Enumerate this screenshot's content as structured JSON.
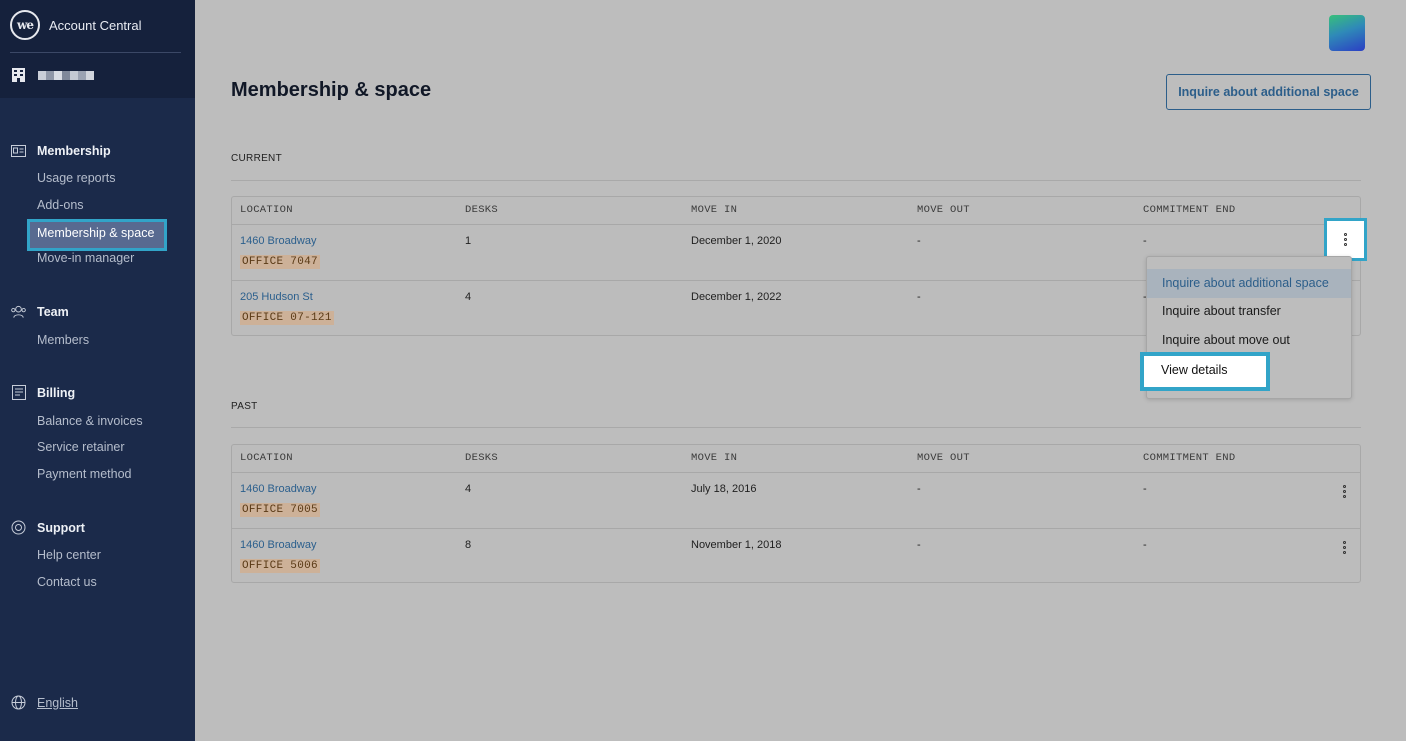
{
  "app": {
    "name": "Account Central",
    "logo_text": "we"
  },
  "sidebar": {
    "sections": [
      {
        "label": "Membership",
        "icon": "id-card-icon",
        "items": [
          "Usage reports",
          "Add-ons",
          "Membership & space",
          "Move-in manager"
        ],
        "active": "Membership & space"
      },
      {
        "label": "Team",
        "icon": "team-icon",
        "items": [
          "Members"
        ]
      },
      {
        "label": "Billing",
        "icon": "receipt-icon",
        "items": [
          "Balance & invoices",
          "Service retainer",
          "Payment method"
        ]
      },
      {
        "label": "Support",
        "icon": "lifebuoy-icon",
        "items": [
          "Help center",
          "Contact us"
        ]
      }
    ],
    "language": "English"
  },
  "header": {
    "title": "Membership & space",
    "inquire_button": "Inquire about additional space"
  },
  "columns": [
    "LOCATION",
    "DESKS",
    "MOVE IN",
    "MOVE OUT",
    "COMMITMENT END"
  ],
  "current": {
    "heading": "CURRENT",
    "rows": [
      {
        "location": "1460 Broadway",
        "office": "OFFICE 7047",
        "desks": "1",
        "move_in": "December 1, 2020",
        "move_out": "-",
        "commitment_end": "-"
      },
      {
        "location": "205 Hudson St",
        "office": "OFFICE 07-121",
        "desks": "4",
        "move_in": "December 1, 2022",
        "move_out": "-",
        "commitment_end": "-"
      }
    ]
  },
  "past": {
    "heading": "PAST",
    "rows": [
      {
        "location": "1460 Broadway",
        "office": "OFFICE 7005",
        "desks": "4",
        "move_in": "July 18, 2016",
        "move_out": "-",
        "commitment_end": "-"
      },
      {
        "location": "1460 Broadway",
        "office": "OFFICE 5006",
        "desks": "8",
        "move_in": "November 1, 2018",
        "move_out": "-",
        "commitment_end": "-"
      }
    ]
  },
  "row_menu": {
    "items": [
      "Inquire about additional space",
      "Inquire about transfer",
      "Inquire about move out",
      "View details"
    ],
    "highlighted": "Inquire about additional space"
  },
  "colors": {
    "sidebar": "#1b2a4a",
    "accent": "#32a4c8",
    "link": "#2b5f8d",
    "office_badge": "#cdb198"
  }
}
